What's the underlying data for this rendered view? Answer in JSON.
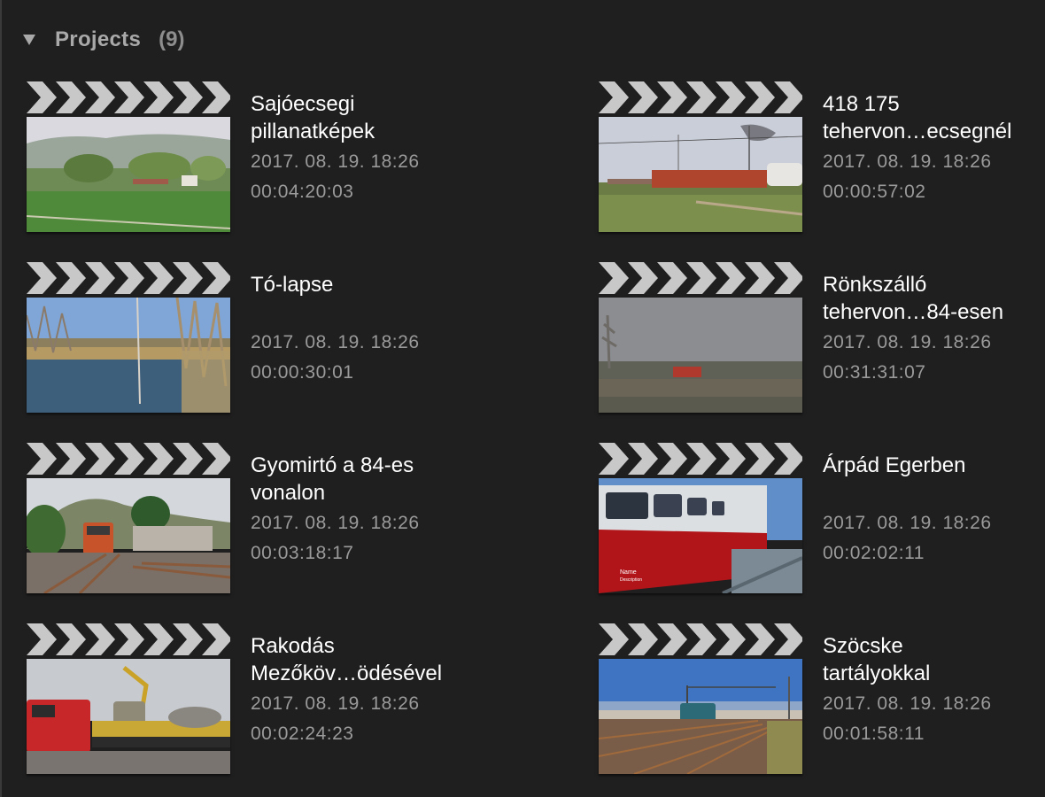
{
  "section": {
    "title": "Projects",
    "count": "(9)",
    "expanded_icon": "disclosure-triangle-down-icon"
  },
  "projects": [
    {
      "name": "Sajóecsegi\npillanatképek",
      "date": "2017. 08. 19. 18:26",
      "duration": "00:04:20:03",
      "thumbnail": "green field with trees and hills"
    },
    {
      "name": "418 175\ntehervon…ecsegnél",
      "date": "2017. 08. 19. 18:26",
      "duration": "00:00:57:02",
      "thumbnail": "freight train with red wagons"
    },
    {
      "name": "Tó-lapse",
      "date": "2017. 08. 19. 18:26",
      "duration": "00:00:30:01",
      "thumbnail": "lake with bare trees"
    },
    {
      "name": "Rönkszálló\ntehervon…84-esen",
      "date": "2017. 08. 19. 18:26",
      "duration": "00:31:31:07",
      "thumbnail": "grey landscape with red building"
    },
    {
      "name": "Gyomirtó a 84-es\nvonalon",
      "date": "2017. 08. 19. 18:26",
      "duration": "00:03:18:17",
      "thumbnail": "locomotive on tracks near station"
    },
    {
      "name": "Árpád Egerben",
      "date": "2017. 08. 19. 18:26",
      "duration": "00:02:02:11",
      "thumbnail": "red and white railcar",
      "overlay": {
        "name": "Name",
        "description": "Description"
      }
    },
    {
      "name": "Rakodás\nMezőköv…ödésével",
      "date": "2017. 08. 19. 18:26",
      "duration": "00:02:24:23",
      "thumbnail": "red locomotive and excavator"
    },
    {
      "name": "Szöcske\ntartályokkal",
      "date": "2017. 08. 19. 18:26",
      "duration": "00:01:58:11",
      "thumbnail": "railway yard under blue sky"
    }
  ]
}
